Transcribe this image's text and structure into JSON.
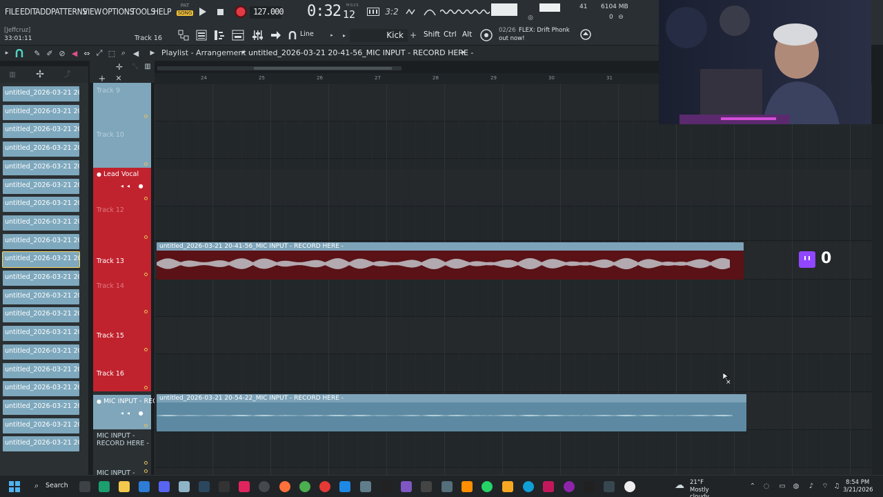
{
  "menu": [
    "FILE",
    "EDIT",
    "ADD",
    "PATTERNS",
    "VIEW",
    "OPTIONS",
    "TOOLS",
    "HELP"
  ],
  "transport": {
    "pat_label": "PAT",
    "song_label": "SONG",
    "tempo": "127.000",
    "time_main": "0:32",
    "time_sub": "12",
    "time_unit": "M:S:CS",
    "cpu_count": "41",
    "memory": "6104 MB",
    "poly": "0"
  },
  "info": {
    "user": "[Jeffcruz]",
    "elapsed": "33:01:11",
    "track_hint": "Track 16",
    "snap": "Line",
    "channel": "Kick",
    "mods": [
      "Shift",
      "Ctrl",
      "Alt"
    ],
    "news_count": "02/26",
    "news_text": "FLEX: Drift Phonk",
    "news_text2": "out now!"
  },
  "playlist": {
    "title": "Playlist - Arrangement",
    "pattern": "untitled_2026-03-21 20-41-56_MIC INPUT - RECORD HERE -",
    "ruler": [
      "24",
      "25",
      "26",
      "27",
      "28",
      "29",
      "30",
      "31"
    ]
  },
  "browser": {
    "items": [
      "untitled_2026-03-21 20-...",
      "untitled_2026-03-21 20-...",
      "untitled_2026-03-21 20-...",
      "untitled_2026-03-21 20-...",
      "untitled_2026-03-21 20-...",
      "untitled_2026-03-21 20-...",
      "untitled_2026-03-21 20-...",
      "untitled_2026-03-21 20-...",
      "untitled_2026-03-21 20-...",
      "untitled_2026-03-21 20-...",
      "untitled_2026-03-21 20-...",
      "untitled_2026-03-21 20-...",
      "untitled_2026-03-21 20-...",
      "untitled_2026-03-21 20-...",
      "untitled_2026-03-21 20-...",
      "untitled_2026-03-21 20-...",
      "untitled_2026-03-21 20-...",
      "untitled_2026-03-21 20-...",
      "untitled_2026-03-21 20-...",
      "untitled_2026-03-21 20-..."
    ]
  },
  "tracks": [
    {
      "label": "Track 9"
    },
    {
      "label": "Track 10"
    },
    {
      "label": "Lead Vocal"
    },
    {
      "label": "Track 12"
    },
    {
      "label": "Track 13"
    },
    {
      "label": "Track 14"
    },
    {
      "label": "Track 15"
    },
    {
      "label": "Track 16"
    },
    {
      "label": "MIC INPUT - REC..."
    },
    {
      "label": "MIC INPUT - RECORD HERE -"
    },
    {
      "label": "MIC INPUT -"
    }
  ],
  "clips": [
    {
      "title": "untitled_2026-03-21 20-41-56_MIC INPUT - RECORD HERE -"
    },
    {
      "title": "untitled_2026-03-21 20-54-22_MIC INPUT - RECORD HERE -"
    }
  ],
  "overlay": {
    "viewer_count": "0"
  },
  "taskbar": {
    "search": "Search",
    "weather_temp": "21°F",
    "weather_desc": "Mostly cloudy",
    "time": "8:54 PM",
    "date": "3/21/2026"
  },
  "colors": {
    "accent_red": "#c0232e",
    "clip_blue": "#7da3b9",
    "clip_red_body": "#5a1216",
    "waveform": "#d9ecf3"
  }
}
